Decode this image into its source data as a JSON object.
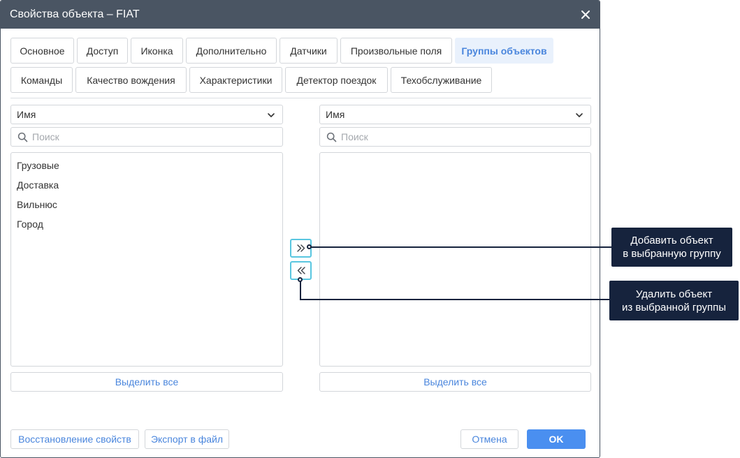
{
  "dialog": {
    "title": "Свойства объекта – FIAT",
    "close_icon": "close-icon"
  },
  "tabs": [
    {
      "label": "Основное"
    },
    {
      "label": "Доступ"
    },
    {
      "label": "Иконка"
    },
    {
      "label": "Дополнительно"
    },
    {
      "label": "Датчики"
    },
    {
      "label": "Произвольные поля"
    },
    {
      "label": "Группы объектов",
      "active": true
    },
    {
      "label": "Команды"
    },
    {
      "label": "Качество вождения"
    },
    {
      "label": "Характеристики"
    },
    {
      "label": "Детектор поездок"
    },
    {
      "label": "Техобслуживание"
    }
  ],
  "left_panel": {
    "sort_select": "Имя",
    "search_placeholder": "Поиск",
    "items": [
      "Грузовые",
      "Доставка",
      "Вильнюс",
      "Город"
    ],
    "select_all": "Выделить все"
  },
  "right_panel": {
    "sort_select": "Имя",
    "search_placeholder": "Поиск",
    "items": [],
    "select_all": "Выделить все"
  },
  "transfer": {
    "add_icon": "double-chevron-right-icon",
    "remove_icon": "double-chevron-left-icon"
  },
  "footer": {
    "restore": "Восстановление свойств",
    "export": "Экспорт в файл",
    "cancel": "Отмена",
    "ok": "OK"
  },
  "callouts": {
    "add_line1": "Добавить объект",
    "add_line2": "в выбранную группу",
    "remove_line1": "Удалить объект",
    "remove_line2": "из выбранной группы"
  },
  "colors": {
    "titlebar": "#4a5563",
    "accent": "#4a86dd",
    "ok_button": "#4a8ff0",
    "transfer_border": "#59c6e0",
    "callout_bg": "#16233d"
  }
}
